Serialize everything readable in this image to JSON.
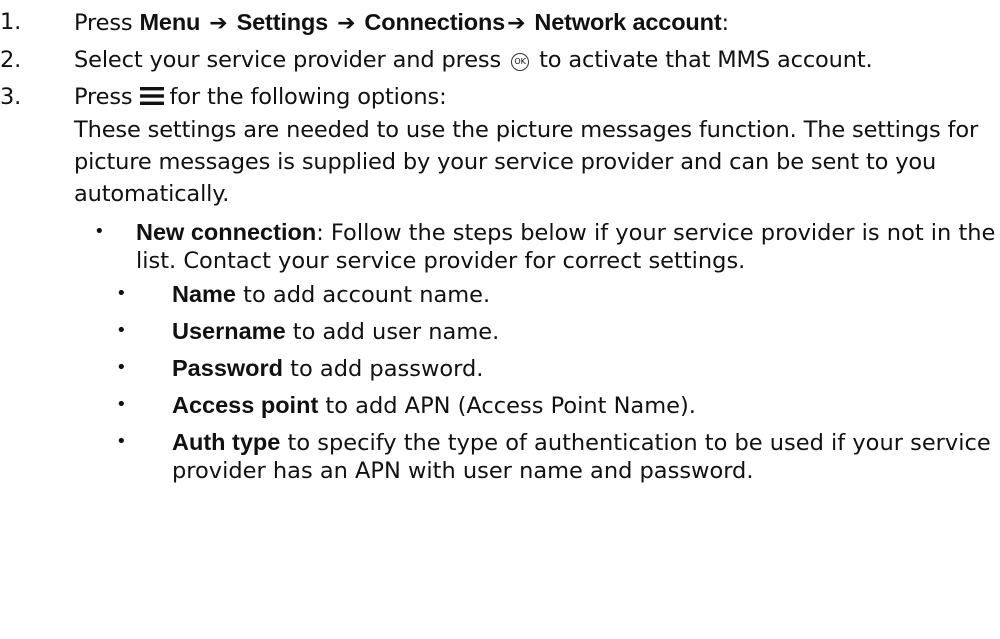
{
  "steps": [
    {
      "number": "1.",
      "press": "Press",
      "menu": "Menu",
      "settings": "Settings",
      "connections": "Connections",
      "network_account": "Network account",
      "colon": ":"
    },
    {
      "number": "2.",
      "text_before": "Select your service provider and press",
      "ok_icon_label": "OK",
      "text_after": "to activate that MMS account."
    },
    {
      "number": "3.",
      "text_before": "Press",
      "text_after": "for the following options:",
      "note": "These settings are needed to use the picture messages function. The settings for picture messages is supplied by your service provider and can be sent to you automatically."
    }
  ],
  "bullets": [
    {
      "term": "New connection",
      "text": ": Follow the steps below if your service provider is not in the list. Contact your service provider for correct settings.",
      "sub": [
        {
          "term": "Name",
          "text": " to add account name."
        },
        {
          "term": "Username",
          "text": " to add user name."
        },
        {
          "term": "Password",
          "text": " to add password."
        },
        {
          "term": "Access point",
          "text": " to add APN (Access Point Name)."
        },
        {
          "term": "Auth type",
          "text": " to specify the type of authentication to be used if your service provider has an APN with user name and password."
        }
      ]
    }
  ],
  "bullet_char": "•",
  "arrow_char": "➔",
  "icons": [
    "arrow-right-icon",
    "ok-button-icon",
    "menu-icon"
  ]
}
